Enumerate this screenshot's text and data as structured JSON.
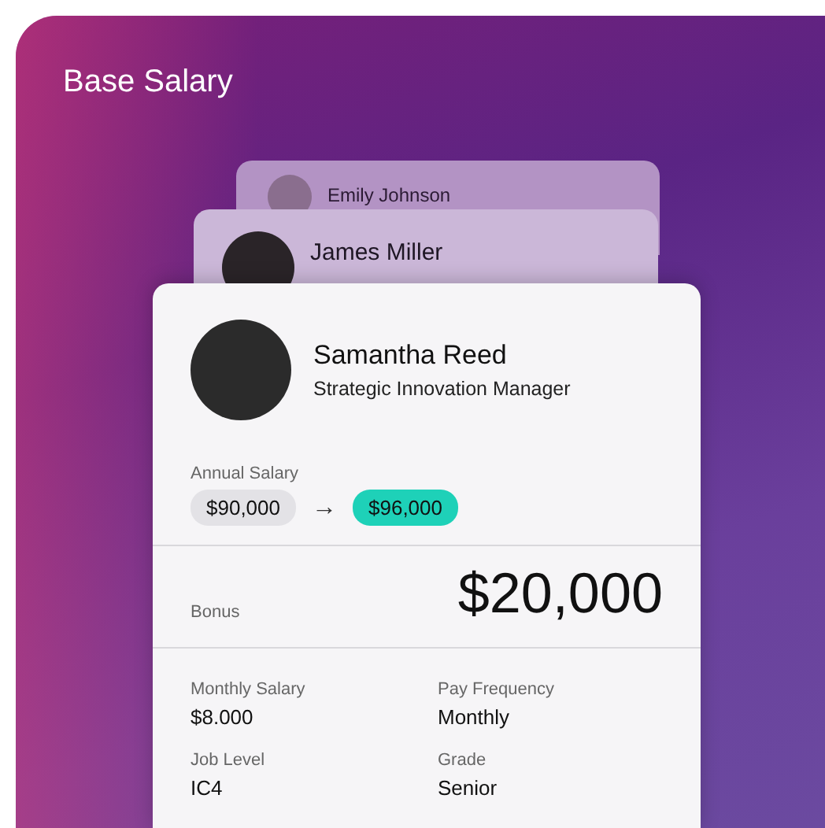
{
  "title": "Base Salary",
  "stack": [
    {
      "name": "Emily Johnson"
    },
    {
      "name": "James Miller"
    }
  ],
  "employee": {
    "name": "Samantha Reed",
    "role": "Strategic Innovation Manager"
  },
  "annual_salary": {
    "label": "Annual Salary",
    "from": "$90,000",
    "arrow": "→",
    "to": "$96,000"
  },
  "bonus": {
    "label": "Bonus",
    "amount": "$20,000"
  },
  "details": [
    {
      "label": "Monthly Salary",
      "value": "$8.000"
    },
    {
      "label": "Pay Frequency",
      "value": "Monthly"
    },
    {
      "label": "Job Level",
      "value": "IC4"
    },
    {
      "label": "Grade",
      "value": "Senior"
    }
  ]
}
